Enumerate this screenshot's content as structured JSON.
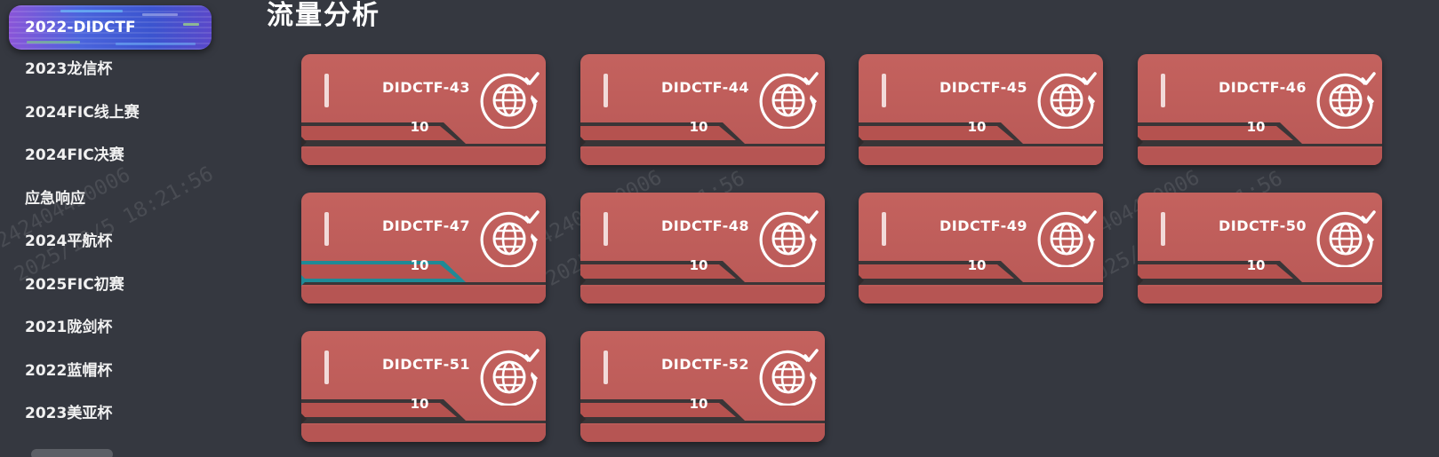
{
  "sidebar": {
    "active": "2022-DIDCTF",
    "items": [
      "2023龙信杯",
      "2024FIC线上赛",
      "2024FIC决赛",
      "应急响应",
      "2024平航杯",
      "2025FIC初赛",
      "2021陇剑杯",
      "2022蓝帽杯",
      "2023美亚杯"
    ]
  },
  "page": {
    "title": "流量分析"
  },
  "watermark": {
    "id": "242404430006",
    "time": "2025/10/5 18:21:56"
  },
  "cards": [
    {
      "name": "DIDCTF-43",
      "score": "10",
      "selected": false
    },
    {
      "name": "DIDCTF-44",
      "score": "10",
      "selected": false
    },
    {
      "name": "DIDCTF-45",
      "score": "10",
      "selected": false
    },
    {
      "name": "DIDCTF-46",
      "score": "10",
      "selected": false
    },
    {
      "name": "DIDCTF-47",
      "score": "10",
      "selected": true
    },
    {
      "name": "DIDCTF-48",
      "score": "10",
      "selected": false
    },
    {
      "name": "DIDCTF-49",
      "score": "10",
      "selected": false
    },
    {
      "name": "DIDCTF-50",
      "score": "10",
      "selected": false
    },
    {
      "name": "DIDCTF-51",
      "score": "10",
      "selected": false
    },
    {
      "name": "DIDCTF-52",
      "score": "10",
      "selected": false
    }
  ],
  "colors": {
    "background": "#353840",
    "card": "#c4625e",
    "selected_accent": "#1f8a96",
    "stripe_dark": "#3a3537"
  },
  "icons": {
    "card_icon": "globe-refresh-check-icon"
  }
}
